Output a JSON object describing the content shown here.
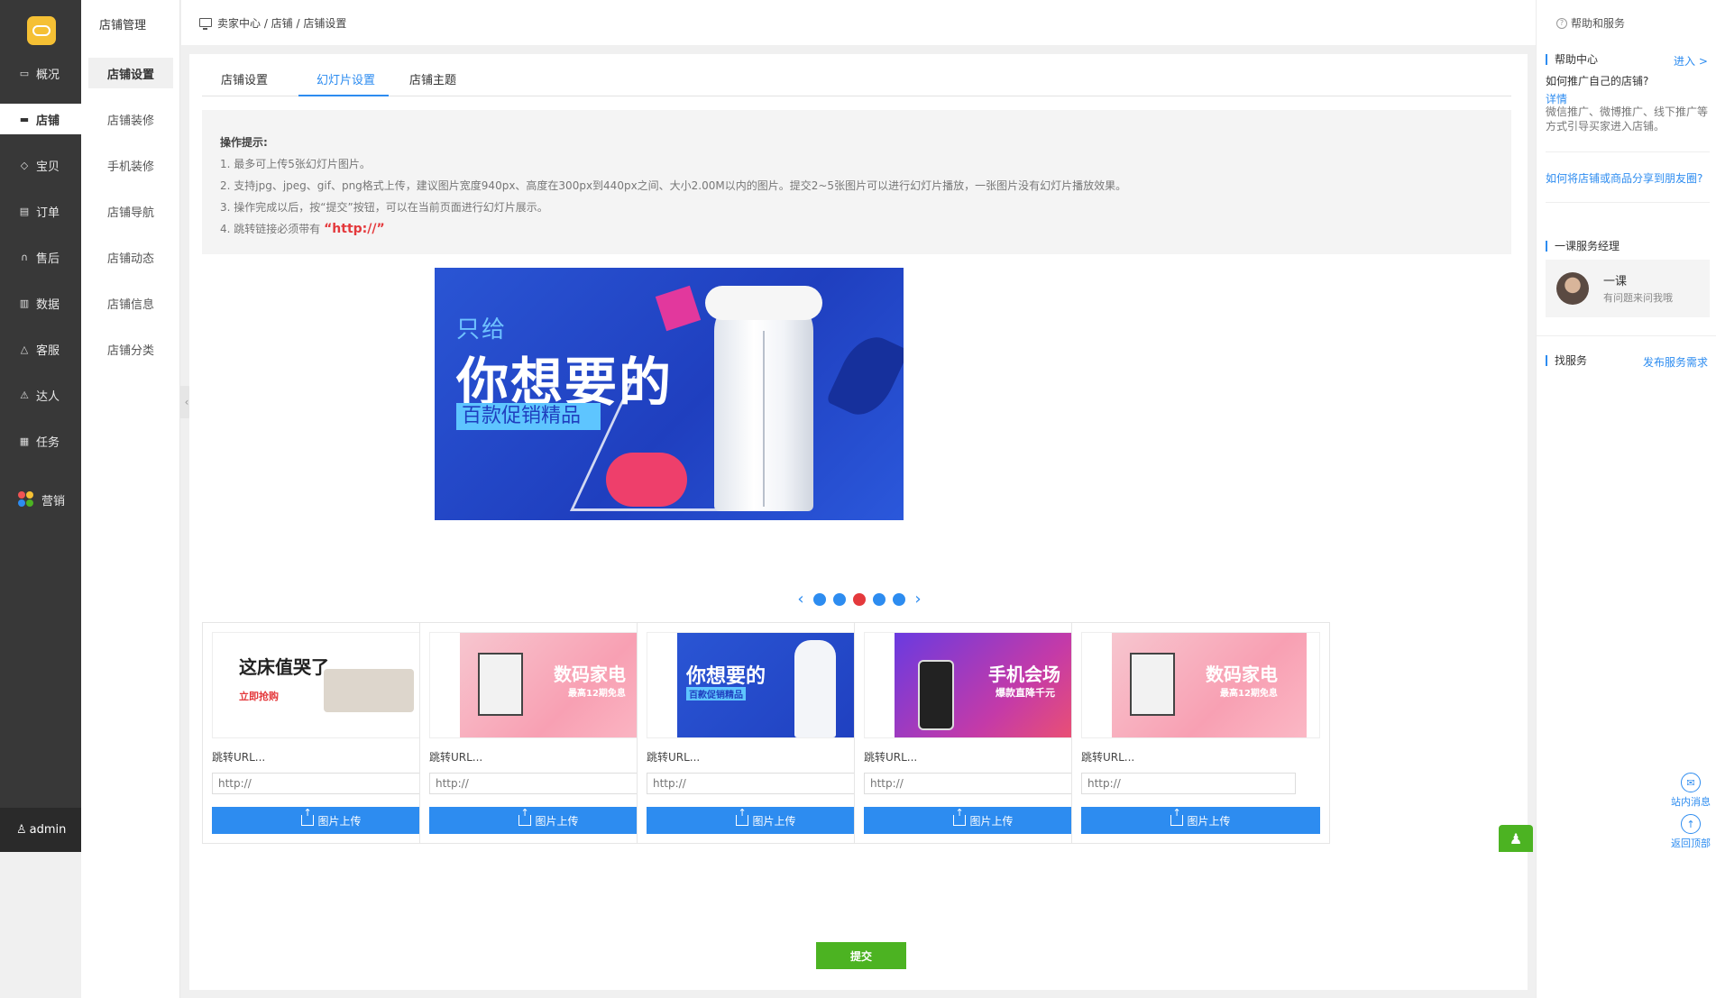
{
  "sidebar": {
    "items": [
      {
        "label": "概况",
        "icon": "monitor-icon"
      },
      {
        "label": "店铺",
        "icon": "store-icon",
        "active": true
      },
      {
        "label": "宝贝",
        "icon": "tag-icon"
      },
      {
        "label": "订单",
        "icon": "order-icon"
      },
      {
        "label": "售后",
        "icon": "headset-icon"
      },
      {
        "label": "数据",
        "icon": "bar-chart-icon"
      },
      {
        "label": "客服",
        "icon": "bell-icon"
      },
      {
        "label": "达人",
        "icon": "warning-icon"
      },
      {
        "label": "任务",
        "icon": "task-icon"
      },
      {
        "label": "营销",
        "icon": "marketing-icon"
      }
    ],
    "user": "admin"
  },
  "subnav": {
    "title": "店铺管理",
    "items": [
      "店铺设置",
      "店铺装修",
      "手机装修",
      "店铺导航",
      "店铺动态",
      "店铺信息",
      "店铺分类"
    ]
  },
  "breadcrumb": "卖家中心 / 店铺 / 店铺设置",
  "tabs": [
    "店铺设置",
    "幻灯片设置",
    "店铺主题"
  ],
  "tips": {
    "title": "操作提示:",
    "lines": [
      "1. 最多可上传5张幻灯片图片。",
      "2. 支持jpg、jpeg、gif、png格式上传，建议图片宽度940px、高度在300px到440px之间、大小2.00M以内的图片。提交2~5张图片可以进行幻灯片播放，一张图片没有幻灯片播放效果。",
      "3. 操作完成以后，按“提交”按钮，可以在当前页面进行幻灯片展示。"
    ],
    "line4_prefix": "4. 跳转链接必须带有",
    "line4_highlight": "“http://”"
  },
  "banner": {
    "small": "只给",
    "big": "你想要的",
    "tag": "百款促销精品"
  },
  "carousel": {
    "count": 5,
    "active_index": 2
  },
  "cards": [
    {
      "thumb_title": "这床值哭了",
      "thumb_sub": "立即抢购",
      "url_label": "跳转URL...",
      "placeholder": "http://",
      "upload_label": "图片上传"
    },
    {
      "thumb_title": "数码家电",
      "thumb_sub": "最高12期免息",
      "url_label": "跳转URL...",
      "placeholder": "http://",
      "upload_label": "图片上传"
    },
    {
      "thumb_title": "你想要的",
      "thumb_sub": "百款促销精品",
      "url_label": "跳转URL...",
      "placeholder": "http://",
      "upload_label": "图片上传"
    },
    {
      "thumb_title": "手机会场",
      "thumb_sub": "爆款直降千元",
      "url_label": "跳转URL...",
      "placeholder": "http://",
      "upload_label": "图片上传"
    },
    {
      "thumb_title": "数码家电",
      "thumb_sub": "最高12期免息",
      "url_label": "跳转URL...",
      "placeholder": "http://",
      "upload_label": "图片上传"
    }
  ],
  "submit_label": "提交",
  "right": {
    "top": "帮助和服务",
    "help_center": "帮助中心",
    "enter": "进入 >",
    "q1": "如何推广自己的店铺?",
    "detail": "详情",
    "desc": "微信推广、微博推广、线下推广等方式引导买家进入店铺。",
    "q2": "如何将店铺或商品分享到朋友圈?",
    "manager_title": "一课服务经理",
    "manager_name": "一课",
    "manager_sub": "有问题来问我哦",
    "find_service": "找服务",
    "publish": "发布服务需求",
    "msg": "站内消息",
    "top_btn": "返回顶部"
  }
}
